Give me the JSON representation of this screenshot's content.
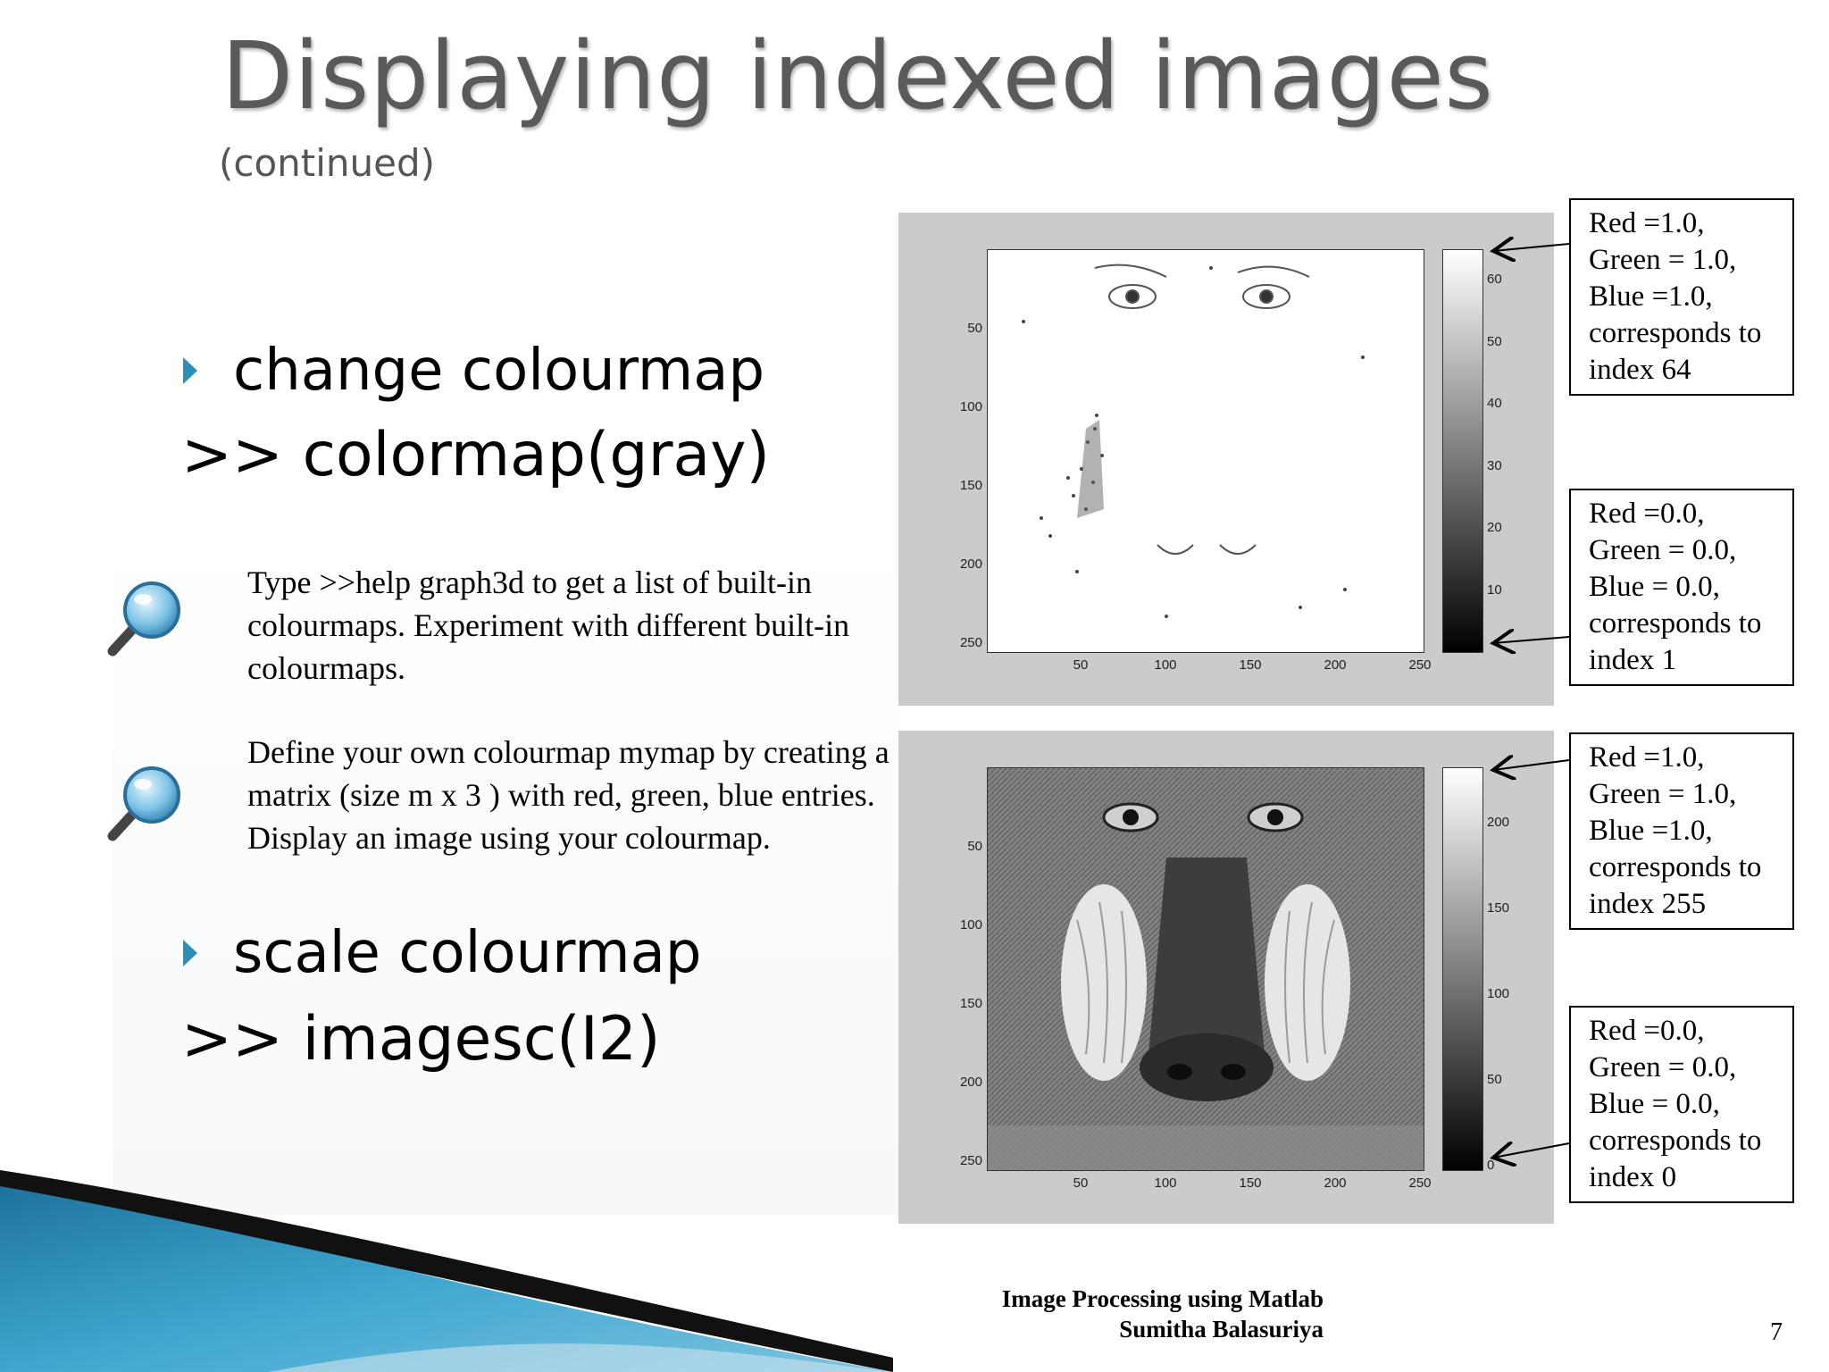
{
  "slide": {
    "title": "Displaying indexed images",
    "subtitle": "(continued)",
    "bullets": [
      {
        "label": "change colourmap",
        "code": ">> colormap(gray)"
      },
      {
        "label": "scale colourmap",
        "code": ">> imagesc(I2)"
      }
    ],
    "tips": [
      {
        "icon": "magnifier-icon",
        "text": "Type >>help graph3d to get a list of built-in colourmaps. Experiment with different built-in colourmaps."
      },
      {
        "icon": "magnifier-icon",
        "text": "Define your own colourmap mymap by creating a matrix (size m x 3 ) with red, green, blue entries. Display an image using your colourmap."
      }
    ]
  },
  "figures": [
    {
      "axis_ticks": {
        "x": [
          "50",
          "100",
          "150",
          "200",
          "250"
        ],
        "y": [
          "50",
          "100",
          "150",
          "200",
          "250"
        ]
      },
      "colorbar_ticks": [
        "60",
        "50",
        "40",
        "30",
        "20",
        "10"
      ],
      "colorbar_range": [
        1,
        64
      ]
    },
    {
      "axis_ticks": {
        "x": [
          "50",
          "100",
          "150",
          "200",
          "250"
        ],
        "y": [
          "50",
          "100",
          "150",
          "200",
          "250"
        ]
      },
      "colorbar_ticks": [
        "200",
        "150",
        "100",
        "50",
        "0"
      ],
      "colorbar_range": [
        0,
        255
      ]
    }
  ],
  "annotations": [
    {
      "lines": [
        "Red =1.0,",
        "Green = 1.0,",
        "Blue =1.0,",
        "corresponds to",
        "index 64"
      ]
    },
    {
      "lines": [
        "Red =0.0,",
        "Green = 0.0,",
        "Blue = 0.0,",
        "corresponds to",
        "index 1"
      ]
    },
    {
      "lines": [
        "Red =1.0,",
        "Green = 1.0,",
        "Blue =1.0,",
        "corresponds to",
        "index 255"
      ]
    },
    {
      "lines": [
        "Red =0.0,",
        "Green = 0.0,",
        "Blue = 0.0,",
        "corresponds to",
        "index 0"
      ]
    }
  ],
  "footer": {
    "line1": "Image Processing using Matlab",
    "line2": "Sumitha Balasuriya",
    "page_number": "7"
  },
  "colors": {
    "accent": "#2b8fb7",
    "swoosh_dark": "#111111",
    "swoosh_blue": "#1f7fa8",
    "panel_bg": "#cbcbcb"
  }
}
